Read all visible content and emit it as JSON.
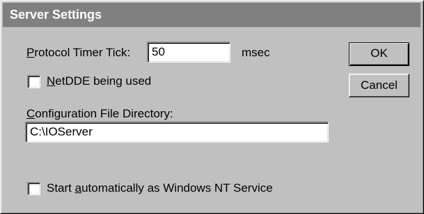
{
  "window": {
    "title": "Server Settings"
  },
  "protocol_timer": {
    "label_mnemonic": "P",
    "label_rest": "rotocol Timer Tick:",
    "value": "50",
    "unit": "msec"
  },
  "netdde": {
    "label_mnemonic": "N",
    "label_rest": "etDDE being used",
    "checked": false
  },
  "config_dir": {
    "label_mnemonic": "C",
    "label_rest": "onfiguration File Directory:",
    "value": "C:\\IOServer"
  },
  "autostart": {
    "label_prefix": "Start ",
    "label_mnemonic": "a",
    "label_rest": "utomatically as Windows NT Service",
    "checked": false
  },
  "buttons": {
    "ok": "OK",
    "cancel": "Cancel"
  }
}
